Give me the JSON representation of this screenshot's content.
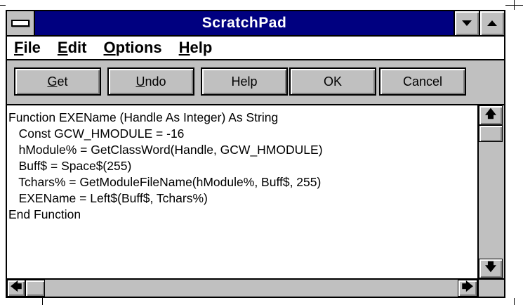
{
  "window": {
    "title": "ScratchPad"
  },
  "menu": [
    {
      "label": "File",
      "mnemonic": "F",
      "rest": "ile"
    },
    {
      "label": "Edit",
      "mnemonic": "E",
      "rest": "dit"
    },
    {
      "label": "Options",
      "mnemonic": "O",
      "rest": "ptions"
    },
    {
      "label": "Help",
      "mnemonic": "H",
      "rest": "elp"
    }
  ],
  "toolbar": {
    "get": {
      "mnemonic": "G",
      "rest": "et"
    },
    "undo": {
      "mnemonic": "U",
      "rest": "ndo"
    },
    "help": "Help",
    "ok": "OK",
    "cancel": "Cancel"
  },
  "editor": {
    "lines": [
      "Function EXEName (Handle As Integer) As String",
      "   Const GCW_HMODULE = -16",
      "   hModule% = GetClassWord(Handle, GCW_HMODULE)",
      "   Buff$ = Space$(255)",
      "   Tchars% = GetModuleFileName(hModule%, Buff$, 255)",
      "   EXEName = Left$(Buff$, Tchars%)",
      "End Function"
    ]
  },
  "icons": {
    "system_menu": "system-menu-icon",
    "minimize": "minimize-arrow-icon",
    "maximize": "maximize-arrow-icon",
    "scroll_up": "up-arrow-icon",
    "scroll_down": "down-arrow-icon",
    "scroll_left": "left-arrow-icon",
    "scroll_right": "right-arrow-icon"
  },
  "colors": {
    "titlebar": "#000080",
    "face": "#c0c0c0"
  }
}
